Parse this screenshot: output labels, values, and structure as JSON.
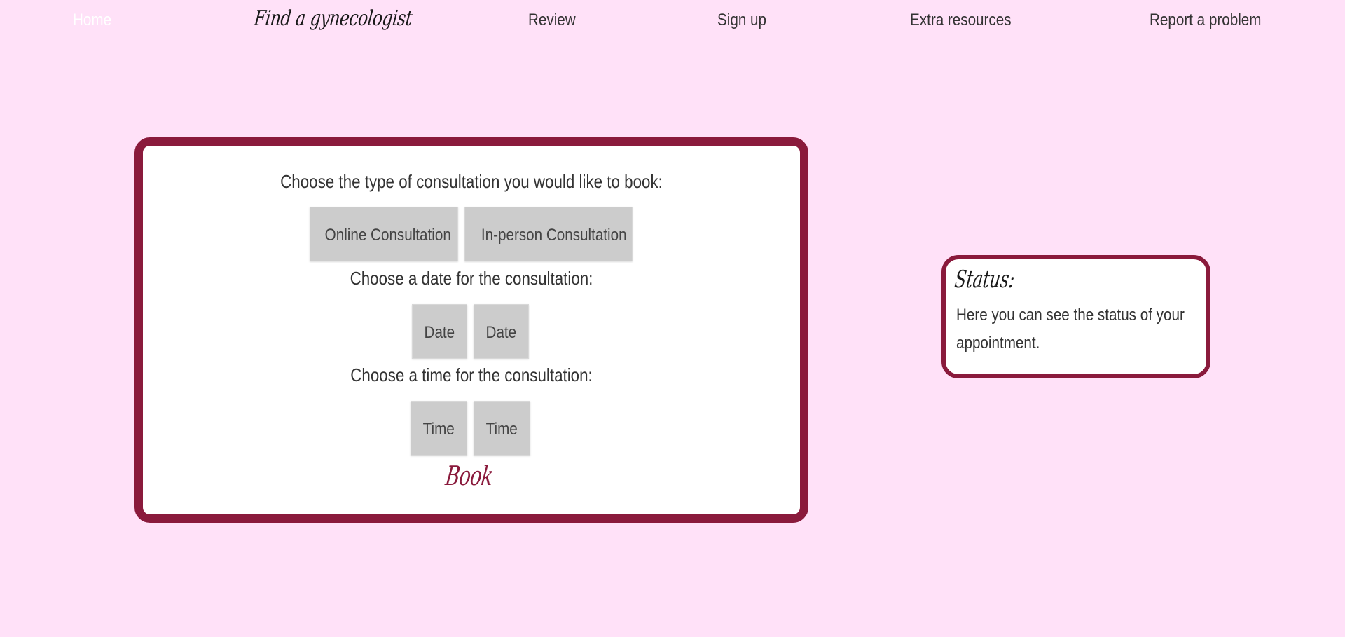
{
  "nav": {
    "home": "Home",
    "logo": "Find a gynecologist",
    "review": "Review",
    "signup": "Sign up",
    "extra_resources": "Extra resources",
    "report": "Report a problem"
  },
  "booking": {
    "type_prompt": "Choose the type of consultation you would like to book:",
    "online_button": "Online Consultation",
    "inperson_button": "In-person Consultation",
    "date_prompt": "Choose a date for the consultation:",
    "date_buttons": [
      "Date",
      "Date"
    ],
    "time_prompt": "Choose a time for the consultation:",
    "time_buttons": [
      "Time",
      "Time"
    ],
    "book_label": "Book"
  },
  "status": {
    "title": "Status:",
    "text": "Here you can see the status of your appointment."
  },
  "colors": {
    "background": "#ffe1f8",
    "accent": "#8a1a3c",
    "button_bg": "#cccccc",
    "text": "#333333"
  }
}
